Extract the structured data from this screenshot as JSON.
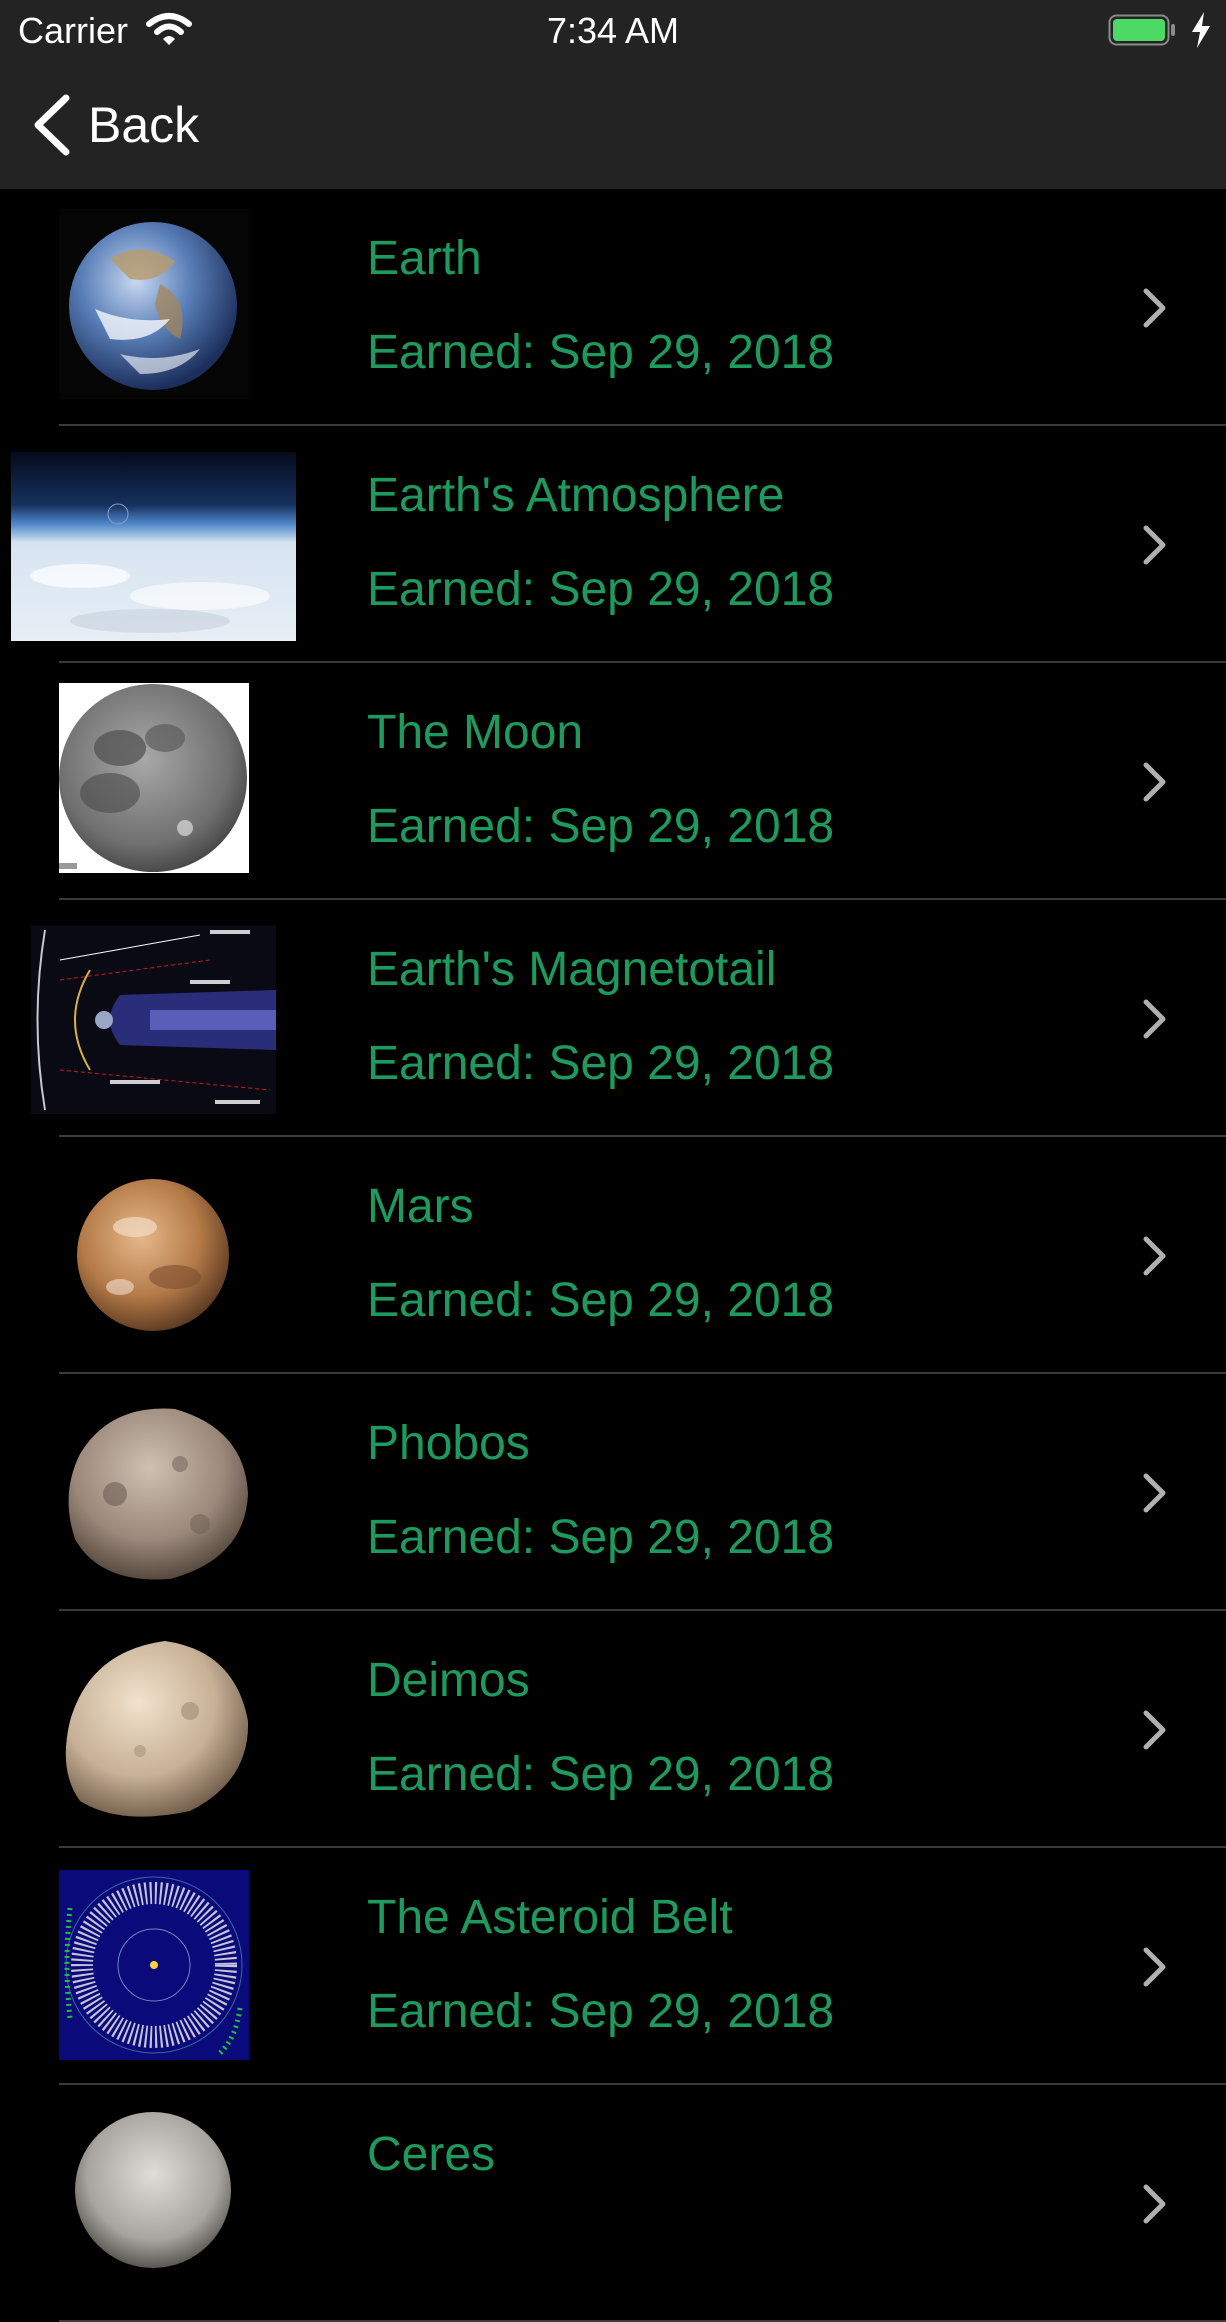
{
  "status_bar": {
    "carrier": "Carrier",
    "time": "7:34 AM",
    "battery_color": "#4cd964"
  },
  "nav": {
    "back_label": "Back"
  },
  "colors": {
    "accent": "#1e9a5e",
    "bar_bg": "#232323",
    "list_bg": "#000000"
  },
  "items": [
    {
      "title": "Earth",
      "earned": "Earned: Sep 29, 2018",
      "thumbnail": "earth-globe-image"
    },
    {
      "title": "Earth's Atmosphere",
      "earned": "Earned: Sep 29, 2018",
      "thumbnail": "atmosphere-horizon-image"
    },
    {
      "title": "The Moon",
      "earned": "Earned: Sep 29, 2018",
      "thumbnail": "moon-image"
    },
    {
      "title": "Earth's Magnetotail",
      "earned": "Earned: Sep 29, 2018",
      "thumbnail": "magnetotail-diagram-image"
    },
    {
      "title": "Mars",
      "earned": "Earned: Sep 29, 2018",
      "thumbnail": "mars-image"
    },
    {
      "title": "Phobos",
      "earned": "Earned: Sep 29, 2018",
      "thumbnail": "phobos-image"
    },
    {
      "title": "Deimos",
      "earned": "Earned: Sep 29, 2018",
      "thumbnail": "deimos-image"
    },
    {
      "title": "The Asteroid Belt",
      "earned": "Earned: Sep 29, 2018",
      "thumbnail": "asteroid-belt-image"
    },
    {
      "title": "Ceres",
      "earned": "",
      "thumbnail": "ceres-image"
    }
  ]
}
